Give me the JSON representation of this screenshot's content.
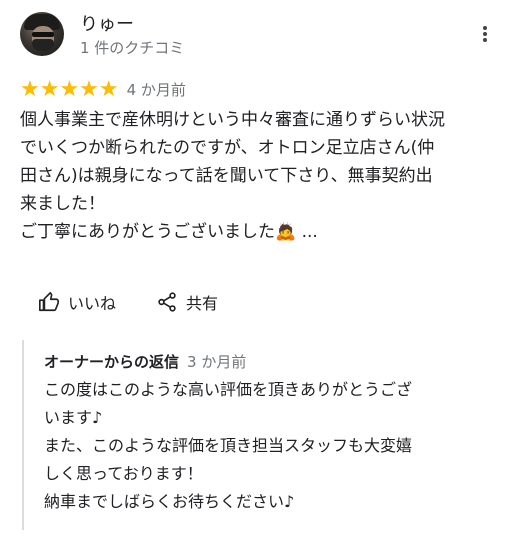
{
  "review": {
    "author": "りゅー",
    "author_meta": "1 件のクチコミ",
    "stars": "★★★★★",
    "rating": 5,
    "date": "4 か月前",
    "text": "個人事業主で産休明けという中々審査に通りずらい状況\nでいくつか断られたのですが、オトロン足立店さん(仲\n田さん)は親身になって話を聞いて下さり、無事契約出\n来ました！\nご丁寧にありがとうございました🙇 ..."
  },
  "actions": {
    "like_label": "いいね",
    "share_label": "共有"
  },
  "reply": {
    "label": "オーナーからの返信",
    "date": "3 か月前",
    "text": "この度はこのような高い評価を頂きありがとうござ\nいます♪\nまた、このような評価を頂き担当スタッフも大変嬉\nしく思っております！\n納車までしばらくお待ちください♪"
  },
  "colors": {
    "star": "#fbbc04",
    "secondary_text": "#70757a",
    "primary_text": "#202124",
    "divider": "#dadce0"
  }
}
